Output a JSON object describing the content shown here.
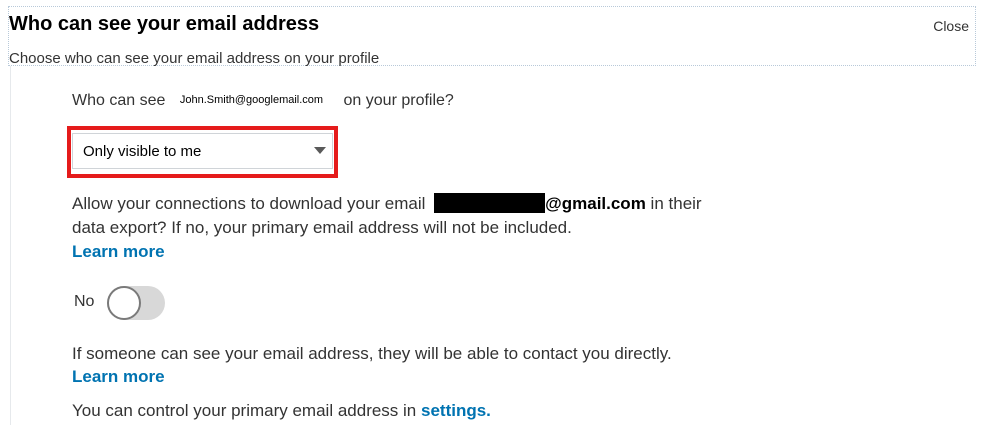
{
  "dialog": {
    "title": "Who can see your email address",
    "subtitle": "Choose who can see your email address on your profile",
    "close_label": "Close"
  },
  "visibility": {
    "question_prefix": "Who can see",
    "email": "John.Smith@googlemail.com",
    "question_suffix": "on your profile?",
    "selected_option": "Only visible to me",
    "highlight_color": "#e51b1b"
  },
  "download": {
    "text_prefix": "Allow your connections to download your email",
    "email_domain": "@gmail.com",
    "text_suffix_1": "in",
    "text_suffix_2": "their data export? If no, your primary email address will not be included.",
    "learn_more": "Learn more"
  },
  "toggle": {
    "label": "No",
    "state": "off"
  },
  "contact": {
    "text": "If someone can see your email address, they will be able to contact you directly.",
    "learn_more": "Learn more"
  },
  "control": {
    "text": "You can control your primary email address in",
    "settings_link": "settings."
  },
  "colors": {
    "link": "#0073b1",
    "highlight": "#e51b1b",
    "toggle_track": "#d8d8d8"
  }
}
